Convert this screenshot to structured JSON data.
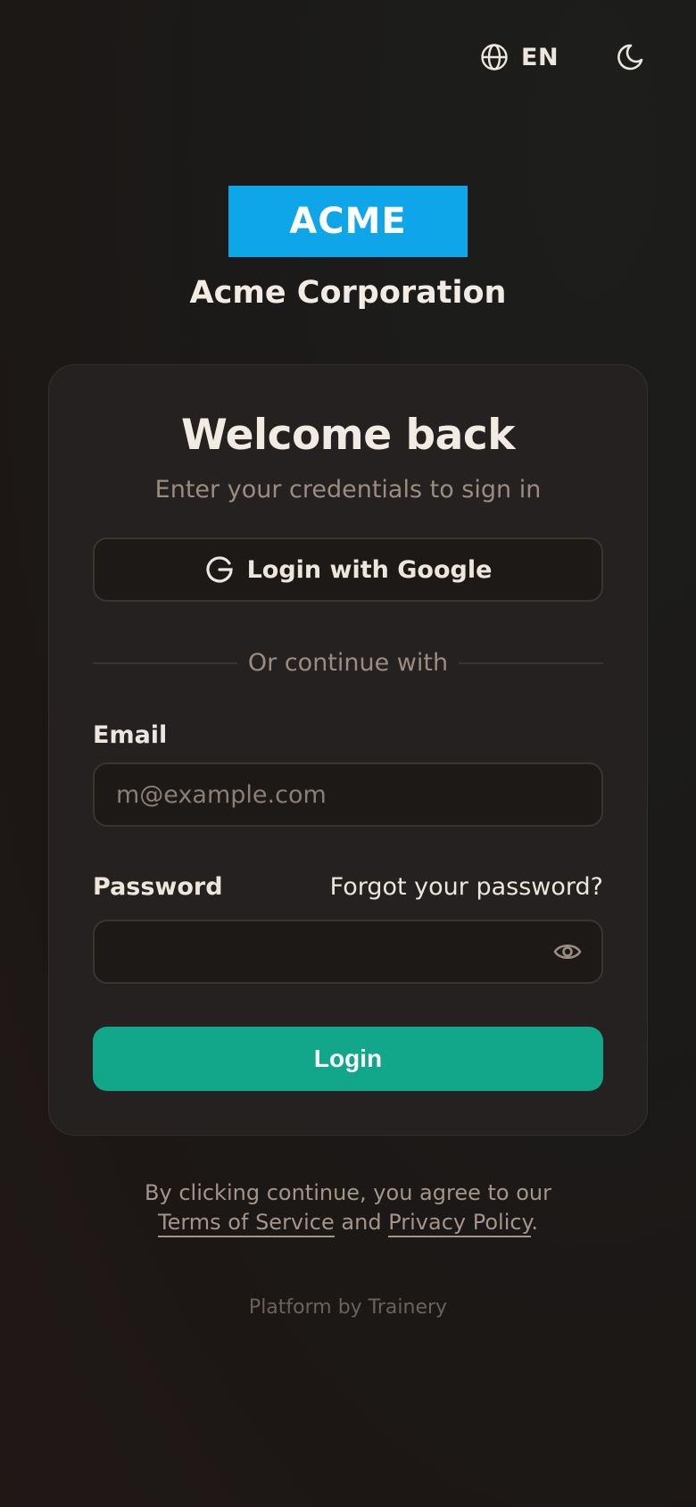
{
  "header": {
    "language": "EN",
    "icons": {
      "language": "globe-icon",
      "theme": "moon-icon"
    }
  },
  "brand": {
    "logo_text": "ACME",
    "logo_color": "#0ea5e9",
    "organization": "Acme Corporation"
  },
  "card": {
    "title": "Welcome back",
    "subtitle": "Enter your credentials to sign in",
    "google_button": "Login with Google",
    "divider": "Or continue with",
    "email_label": "Email",
    "email_placeholder": "m@example.com",
    "email_value": "",
    "password_label": "Password",
    "password_value": "",
    "forgot_password": "Forgot your password?",
    "login_button": "Login",
    "login_color": "#12a68a"
  },
  "footer": {
    "legal_prefix": "By clicking continue, you agree to our",
    "terms": "Terms of Service",
    "and": "and",
    "privacy": "Privacy Policy",
    "period": ".",
    "platform": "Platform by Trainery"
  }
}
